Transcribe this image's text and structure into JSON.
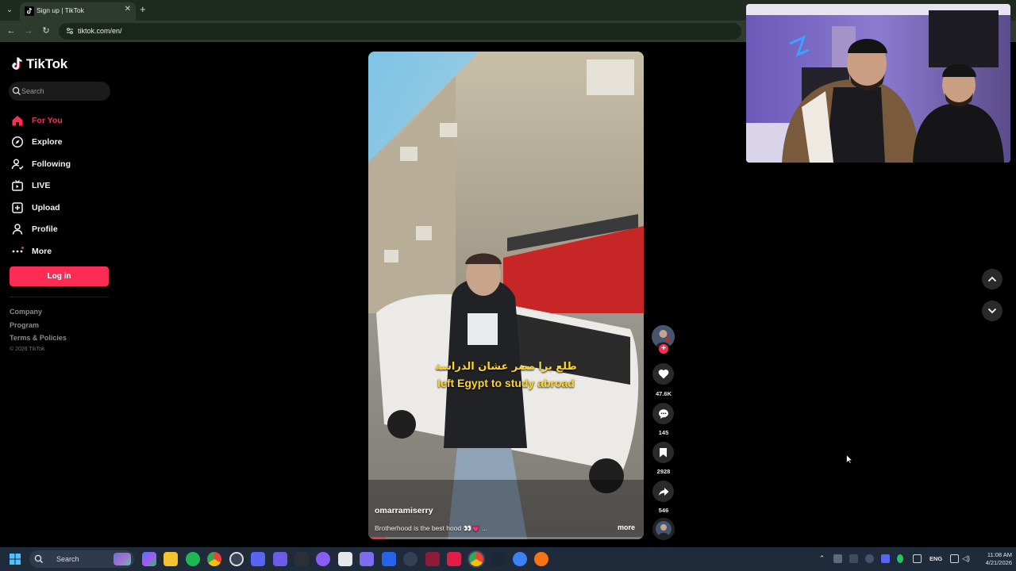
{
  "browser": {
    "tab_title": "Sign up | TikTok",
    "url": "tiktok.com/en/"
  },
  "tiktok": {
    "logo_text": "TikTok",
    "search_placeholder": "Search",
    "nav": [
      {
        "label": "For You",
        "icon": "home-icon",
        "active": true
      },
      {
        "label": "Explore",
        "icon": "compass-icon",
        "active": false
      },
      {
        "label": "Following",
        "icon": "following-icon",
        "active": false
      },
      {
        "label": "LIVE",
        "icon": "live-icon",
        "active": false
      },
      {
        "label": "Upload",
        "icon": "upload-icon",
        "active": false
      },
      {
        "label": "Profile",
        "icon": "profile-icon",
        "active": false
      },
      {
        "label": "More",
        "icon": "more-icon",
        "active": false
      }
    ],
    "login_label": "Log in",
    "footer_links": [
      "Company",
      "Program",
      "Terms & Policies"
    ],
    "copyright": "© 2026 TikTok",
    "accent_color": "#fe2c55"
  },
  "video": {
    "caption_arabic": "طلع برا مصر عشان الدراسة",
    "caption_english": "left Egypt to study abroad",
    "username": "omarramiserry",
    "description": "Brotherhood is the best hood 👀💗 ...",
    "more_label": "more",
    "progress_fraction": 0.06
  },
  "actions": {
    "likes": "47.6K",
    "comments": "145",
    "saves": "2928",
    "shares": "546"
  },
  "taskbar": {
    "search_label": "Search",
    "language": "ENG",
    "time": "11:08 AM",
    "date": "4/21/2026"
  }
}
